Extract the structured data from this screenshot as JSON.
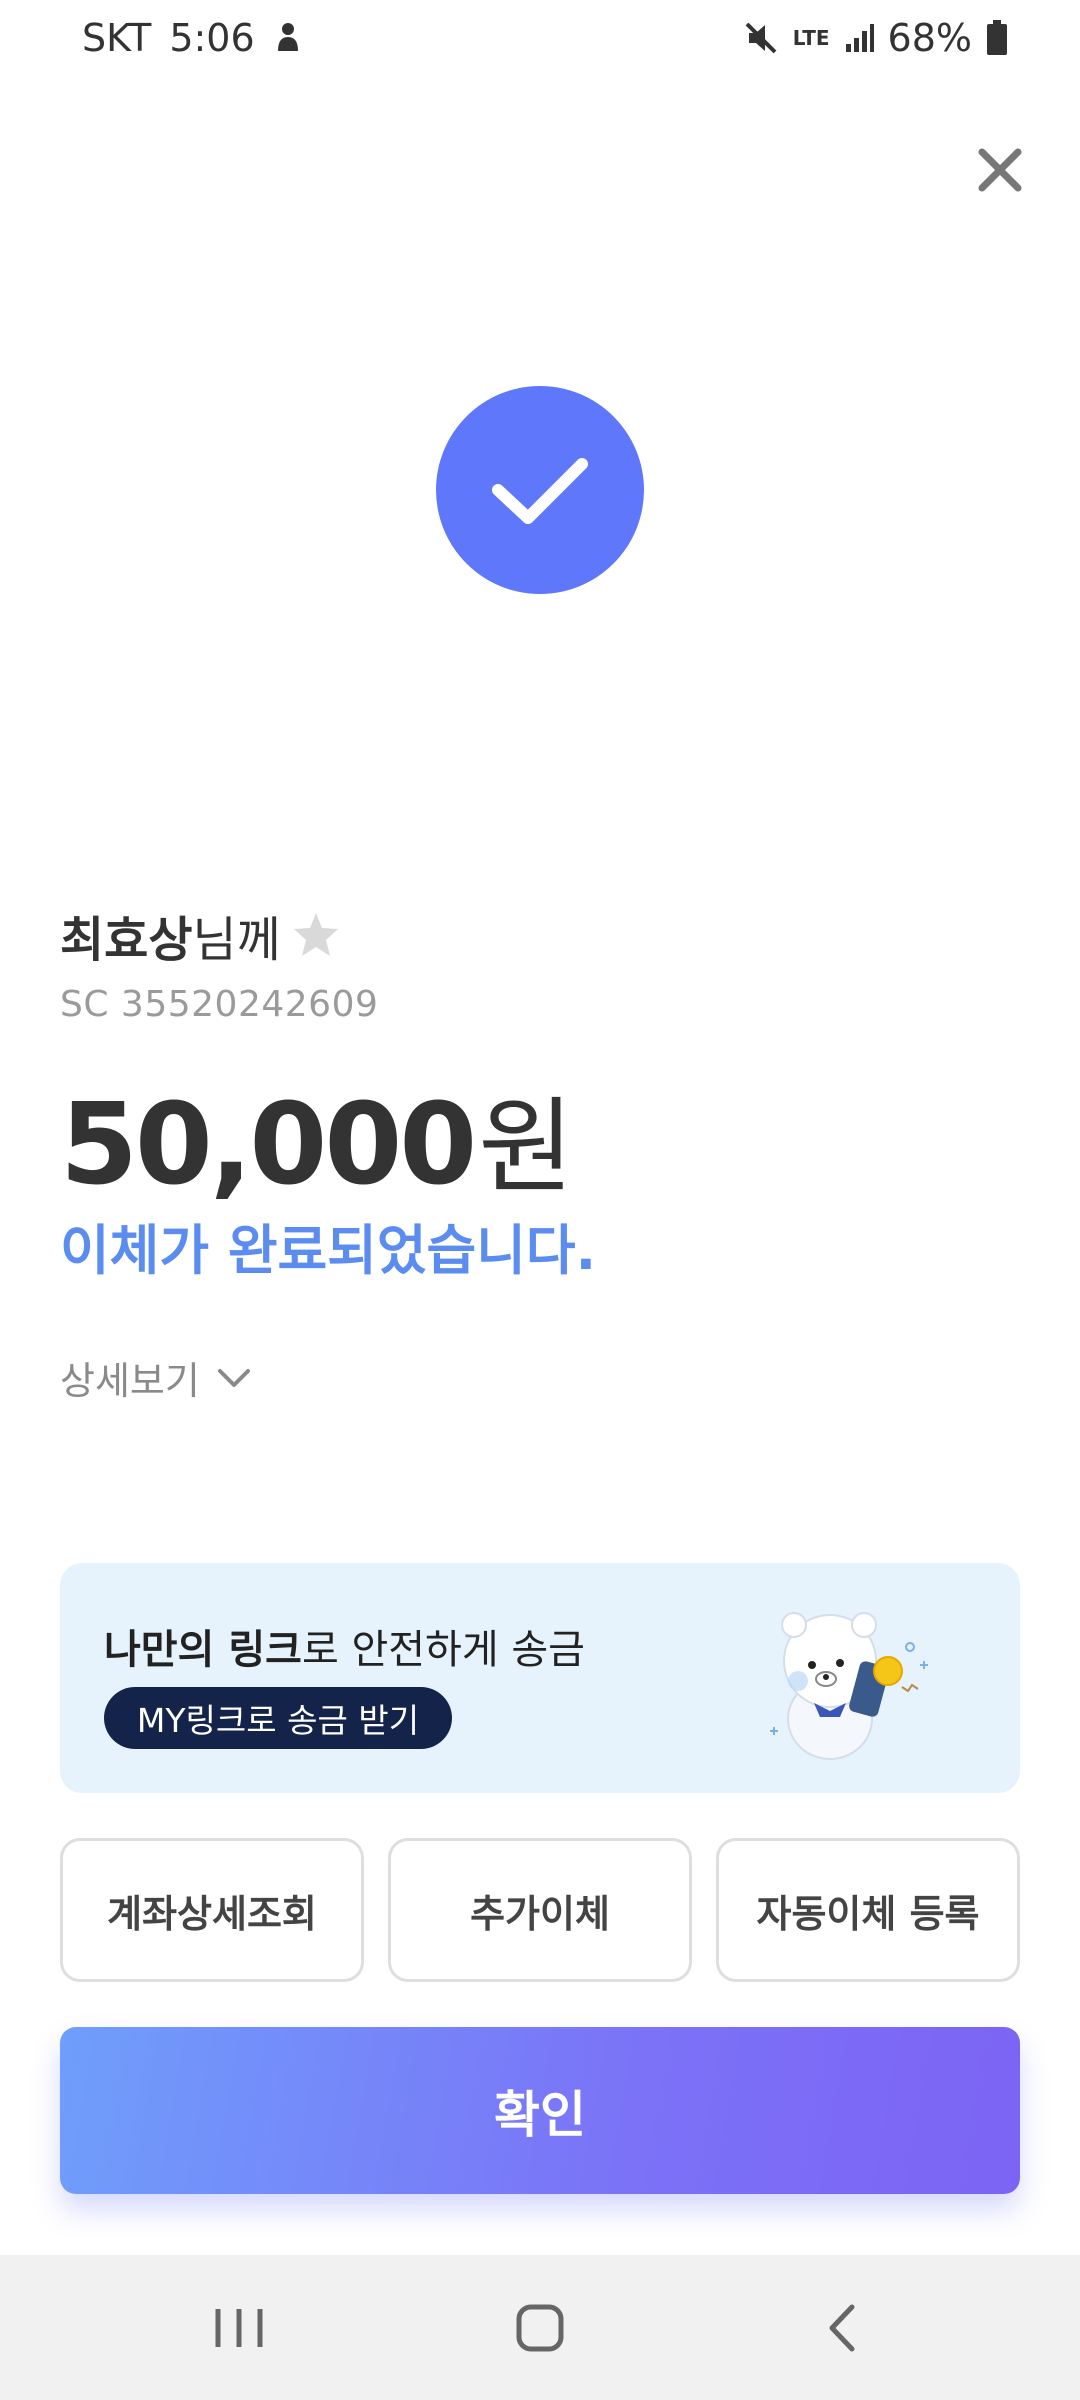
{
  "status_bar": {
    "carrier": "SKT",
    "time": "5:06",
    "network": "LTE",
    "battery": "68%"
  },
  "icons": [
    "close-icon",
    "check-icon",
    "star-icon",
    "chevron-down-icon",
    "mute-icon",
    "signal-icon",
    "battery-icon",
    "bear-mascot"
  ],
  "colors": {
    "accent": "#5f77fb",
    "success_text": "#5b8cf0",
    "banner_bg": "#e6f3fd",
    "pill_bg": "#14234a"
  },
  "transfer": {
    "recipient_name": "최효상",
    "recipient_suffix": "님께",
    "account": "SC 35520242609",
    "amount": "50,000",
    "currency": "원",
    "message": "이체가 완료되었습니다.",
    "details_label": "상세보기"
  },
  "banner": {
    "title_bold": "나만의 링크",
    "title_rest": "로 안전하게 송금",
    "pill_label": "MY링크로 송금 받기"
  },
  "actions": {
    "account_detail": "계좌상세조회",
    "add_transfer": "추가이체",
    "auto_transfer": "자동이체 등록"
  },
  "confirm_label": "확인"
}
